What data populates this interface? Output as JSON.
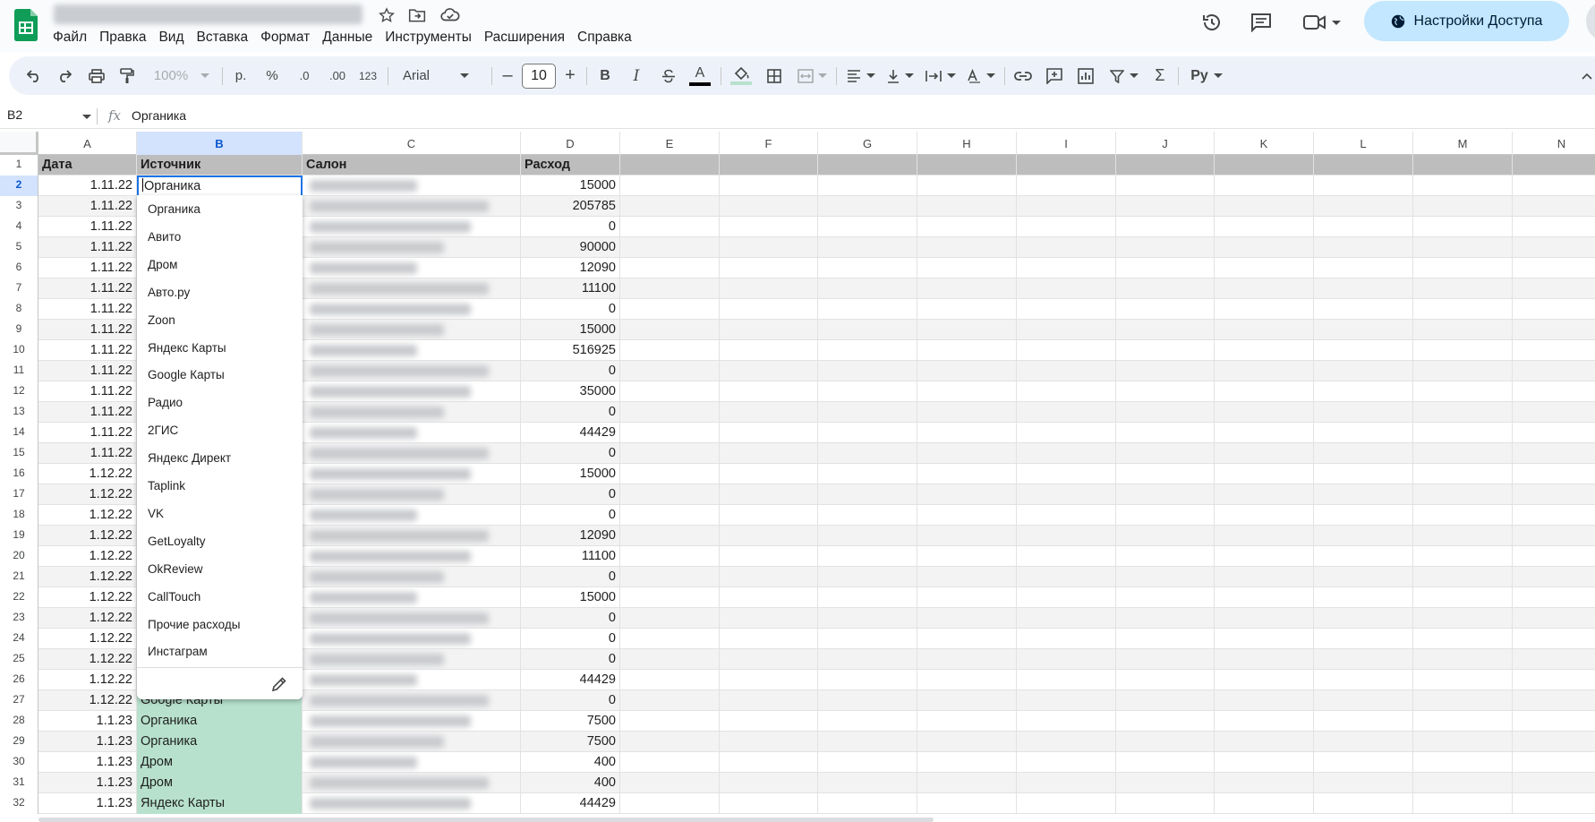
{
  "app": {
    "menu": [
      "Файл",
      "Правка",
      "Вид",
      "Вставка",
      "Формат",
      "Данные",
      "Инструменты",
      "Расширения",
      "Справка"
    ],
    "share_label": "Настройки Доступа",
    "brand_color": "#0f9d58",
    "accent_color": "#c2e7ff"
  },
  "toolbar": {
    "zoom": "100%",
    "currency": "р.",
    "percent": "%",
    "decimal_decrease": ".0",
    "decimal_increase": ".00",
    "format_number": "123",
    "font_name": "Arial",
    "font_size": "10",
    "bold": "B",
    "italic": "I",
    "text_color": "A",
    "input_tools": "Ру"
  },
  "formula_bar": {
    "name_box": "B2",
    "fx": "fx",
    "content": "Органика"
  },
  "columns": [
    "A",
    "B",
    "C",
    "D",
    "E",
    "F",
    "G",
    "H",
    "I",
    "J",
    "K",
    "L",
    "M",
    "N"
  ],
  "selected_column": "B",
  "header_row": {
    "a": "Дата",
    "b": "Источник",
    "c": "Салон",
    "d": "Расход"
  },
  "rows": [
    {
      "n": "2",
      "a": "1.11.22",
      "b": "",
      "d": "15000"
    },
    {
      "n": "3",
      "a": "1.11.22",
      "b": "",
      "d": "205785"
    },
    {
      "n": "4",
      "a": "1.11.22",
      "b": "",
      "d": "0"
    },
    {
      "n": "5",
      "a": "1.11.22",
      "b": "",
      "d": "90000"
    },
    {
      "n": "6",
      "a": "1.11.22",
      "b": "",
      "d": "12090"
    },
    {
      "n": "7",
      "a": "1.11.22",
      "b": "",
      "d": "11100"
    },
    {
      "n": "8",
      "a": "1.11.22",
      "b": "",
      "d": "0"
    },
    {
      "n": "9",
      "a": "1.11.22",
      "b": "",
      "d": "15000"
    },
    {
      "n": "10",
      "a": "1.11.22",
      "b": "",
      "d": "516925"
    },
    {
      "n": "11",
      "a": "1.11.22",
      "b": "",
      "d": "0"
    },
    {
      "n": "12",
      "a": "1.11.22",
      "b": "",
      "d": "35000"
    },
    {
      "n": "13",
      "a": "1.11.22",
      "b": "",
      "d": "0"
    },
    {
      "n": "14",
      "a": "1.11.22",
      "b": "",
      "d": "44429"
    },
    {
      "n": "15",
      "a": "1.11.22",
      "b": "",
      "d": "0"
    },
    {
      "n": "16",
      "a": "1.12.22",
      "b": "",
      "d": "15000"
    },
    {
      "n": "17",
      "a": "1.12.22",
      "b": "",
      "d": "0"
    },
    {
      "n": "18",
      "a": "1.12.22",
      "b": "",
      "d": "0"
    },
    {
      "n": "19",
      "a": "1.12.22",
      "b": "",
      "d": "12090"
    },
    {
      "n": "20",
      "a": "1.12.22",
      "b": "",
      "d": "11100"
    },
    {
      "n": "21",
      "a": "1.12.22",
      "b": "",
      "d": "0"
    },
    {
      "n": "22",
      "a": "1.12.22",
      "b": "",
      "d": "15000"
    },
    {
      "n": "23",
      "a": "1.12.22",
      "b": "",
      "d": "0"
    },
    {
      "n": "24",
      "a": "1.12.22",
      "b": "",
      "d": "0"
    },
    {
      "n": "25",
      "a": "1.12.22",
      "b": "",
      "d": "0"
    },
    {
      "n": "26",
      "a": "1.12.22",
      "b": "",
      "d": "44429"
    },
    {
      "n": "27",
      "a": "1.12.22",
      "b": "Google Карты",
      "d": "0"
    },
    {
      "n": "28",
      "a": "1.1.23",
      "b": "Органика",
      "d": "7500"
    },
    {
      "n": "29",
      "a": "1.1.23",
      "b": "Органика",
      "d": "7500"
    },
    {
      "n": "30",
      "a": "1.1.23",
      "b": "Дром",
      "d": "400"
    },
    {
      "n": "31",
      "a": "1.1.23",
      "b": "Дром",
      "d": "400"
    },
    {
      "n": "32",
      "a": "1.1.23",
      "b": "Яндекс Карты",
      "d": "44429"
    }
  ],
  "active_cell": {
    "ref": "B2",
    "value": "Органика"
  },
  "dropdown_options": [
    "Органика",
    "Авито",
    "Дром",
    "Авто.ру",
    "Zoon",
    "Яндекс Карты",
    "Google Карты",
    "Радио",
    "2ГИС",
    "Яндекс Директ",
    "Taplink",
    "VK",
    "GetLoyalty",
    "OkReview",
    "CallTouch",
    "Прочие расходы",
    "Инстаграм"
  ]
}
